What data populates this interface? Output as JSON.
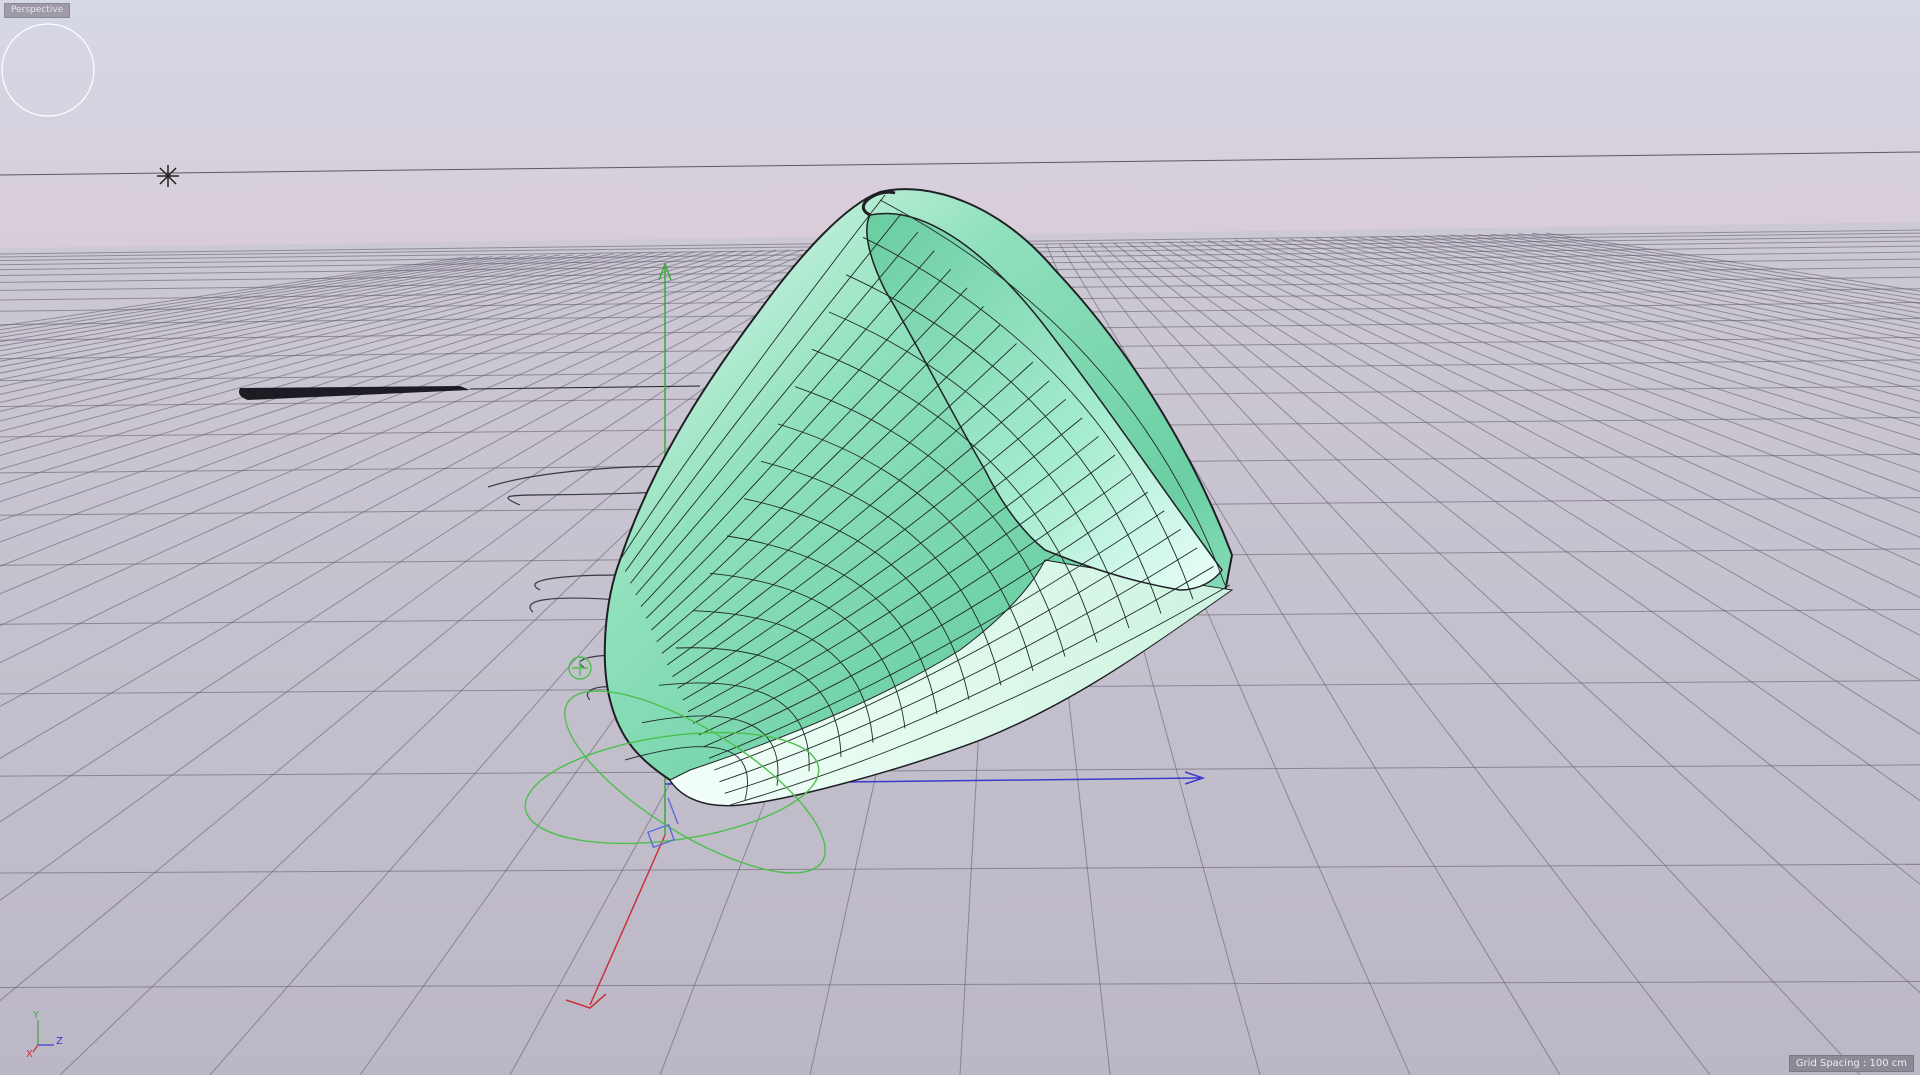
{
  "app": {
    "camera_label": "Perspective",
    "grid_spacing": "Grid Spacing : 100 cm"
  },
  "axis_gizmo": {
    "y": "Y",
    "z": "Z",
    "x": "X"
  },
  "colors": {
    "sky_top": "#d6d6e4",
    "sky_horizon": "#d8ccd8",
    "floor": "#c2bdcb",
    "grid_line": "#5c5868",
    "surface": "#72d4a8",
    "surface_light": "#d6f6e6",
    "axis_x": "#c8323a",
    "axis_y": "#3aaa3a",
    "axis_z": "#3a3ad0"
  },
  "icons": [
    "light-icon",
    "axis-gizmo-icon",
    "move-handle-icon",
    "rotate-handle-icon",
    "camera-target-icon"
  ]
}
